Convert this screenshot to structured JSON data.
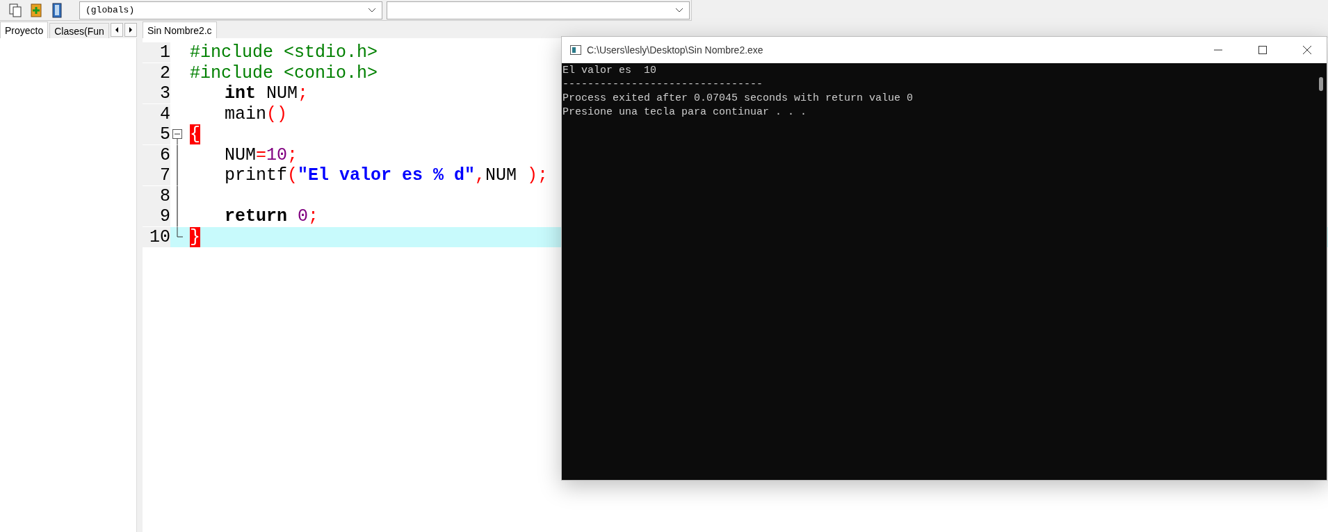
{
  "toolbar": {
    "dropdown": {
      "value": "(globals)"
    }
  },
  "side_tabs": [
    {
      "label": "Proyecto",
      "selected": true
    },
    {
      "label": "Clases(Fun",
      "selected": false
    }
  ],
  "editor": {
    "tabs": [
      {
        "label": "Sin Nombre2.c",
        "selected": true
      }
    ],
    "lines": [
      {
        "number": "1",
        "indented": false,
        "current": false,
        "fold_start": false,
        "in_fold": false,
        "fold_end": false,
        "tokens": [
          {
            "kind": "pre",
            "text": "#include <stdio.h>"
          }
        ]
      },
      {
        "number": "2",
        "indented": false,
        "current": false,
        "fold_start": false,
        "in_fold": false,
        "fold_end": false,
        "tokens": [
          {
            "kind": "pre",
            "text": "#include <conio.h>"
          }
        ]
      },
      {
        "number": "3",
        "indented": true,
        "current": false,
        "fold_start": false,
        "in_fold": false,
        "fold_end": false,
        "tokens": [
          {
            "kind": "keyword",
            "text": "int"
          },
          {
            "kind": "plain",
            "text": " NUM"
          },
          {
            "kind": "symbol",
            "text": ";"
          }
        ]
      },
      {
        "number": "4",
        "indented": true,
        "current": false,
        "fold_start": false,
        "in_fold": false,
        "fold_end": false,
        "tokens": [
          {
            "kind": "plain",
            "text": "main"
          },
          {
            "kind": "symbol",
            "text": "()"
          }
        ]
      },
      {
        "number": "5",
        "indented": false,
        "current": false,
        "fold_start": true,
        "in_fold": false,
        "fold_end": false,
        "tokens": [
          {
            "kind": "brace",
            "text": "{"
          }
        ]
      },
      {
        "number": "6",
        "indented": true,
        "current": false,
        "fold_start": false,
        "in_fold": true,
        "fold_end": false,
        "tokens": [
          {
            "kind": "plain",
            "text": "NUM"
          },
          {
            "kind": "symbol",
            "text": "="
          },
          {
            "kind": "number",
            "text": "10"
          },
          {
            "kind": "symbol",
            "text": ";"
          }
        ]
      },
      {
        "number": "7",
        "indented": true,
        "current": false,
        "fold_start": false,
        "in_fold": true,
        "fold_end": false,
        "tokens": [
          {
            "kind": "plain",
            "text": "printf"
          },
          {
            "kind": "symbol",
            "text": "("
          },
          {
            "kind": "string",
            "text": "\"El valor es % d\""
          },
          {
            "kind": "symbol",
            "text": ","
          },
          {
            "kind": "plain",
            "text": "NUM "
          },
          {
            "kind": "symbol",
            "text": ");"
          }
        ]
      },
      {
        "number": "8",
        "indented": false,
        "current": false,
        "fold_start": false,
        "in_fold": true,
        "fold_end": false
      },
      {
        "number": "9",
        "indented": true,
        "current": false,
        "fold_start": false,
        "in_fold": true,
        "fold_end": false,
        "tokens": [
          {
            "kind": "keyword",
            "text": "return "
          },
          {
            "kind": "number",
            "text": "0"
          },
          {
            "kind": "symbol",
            "text": ";"
          }
        ]
      },
      {
        "number": "10",
        "indented": false,
        "current": true,
        "fold_start": false,
        "in_fold": false,
        "fold_end": true,
        "tokens": [
          {
            "kind": "brace",
            "text": "}"
          }
        ]
      }
    ]
  },
  "console": {
    "title": "C:\\Users\\lesly\\Desktop\\Sin Nombre2.exe",
    "lines": [
      "El valor es  10",
      "--------------------------------",
      "Process exited after 0.07045 seconds with return value 0",
      "Presione una tecla para continuar . . ."
    ]
  }
}
